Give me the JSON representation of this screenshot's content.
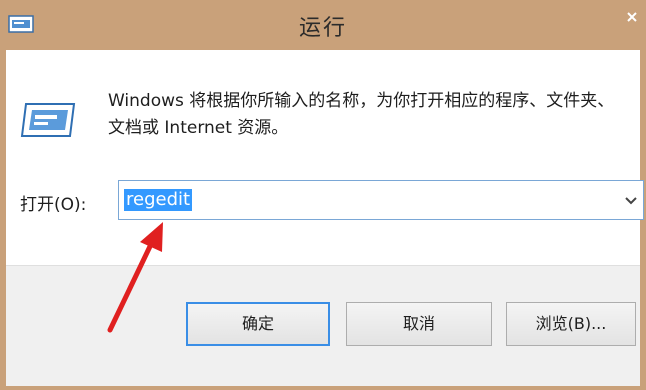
{
  "window": {
    "title": "运行"
  },
  "dialog": {
    "description": "Windows 将根据你所输入的名称，为你打开相应的程序、文件夹、文档或 Internet 资源。",
    "open_label": "打开(O):",
    "open_value": "regedit"
  },
  "buttons": {
    "ok": "确定",
    "cancel": "取消",
    "browse": "浏览(B)..."
  },
  "icons": {
    "app": "run-app-icon",
    "dialog": "run-dialog-icon",
    "dropdown": "chevron-down-icon",
    "annotation": "red-arrow"
  },
  "colors": {
    "title_bar": "#c9a17a",
    "selection": "#3399ff",
    "annotation": "#e02020",
    "default_button_border": "#3a8ee6"
  }
}
